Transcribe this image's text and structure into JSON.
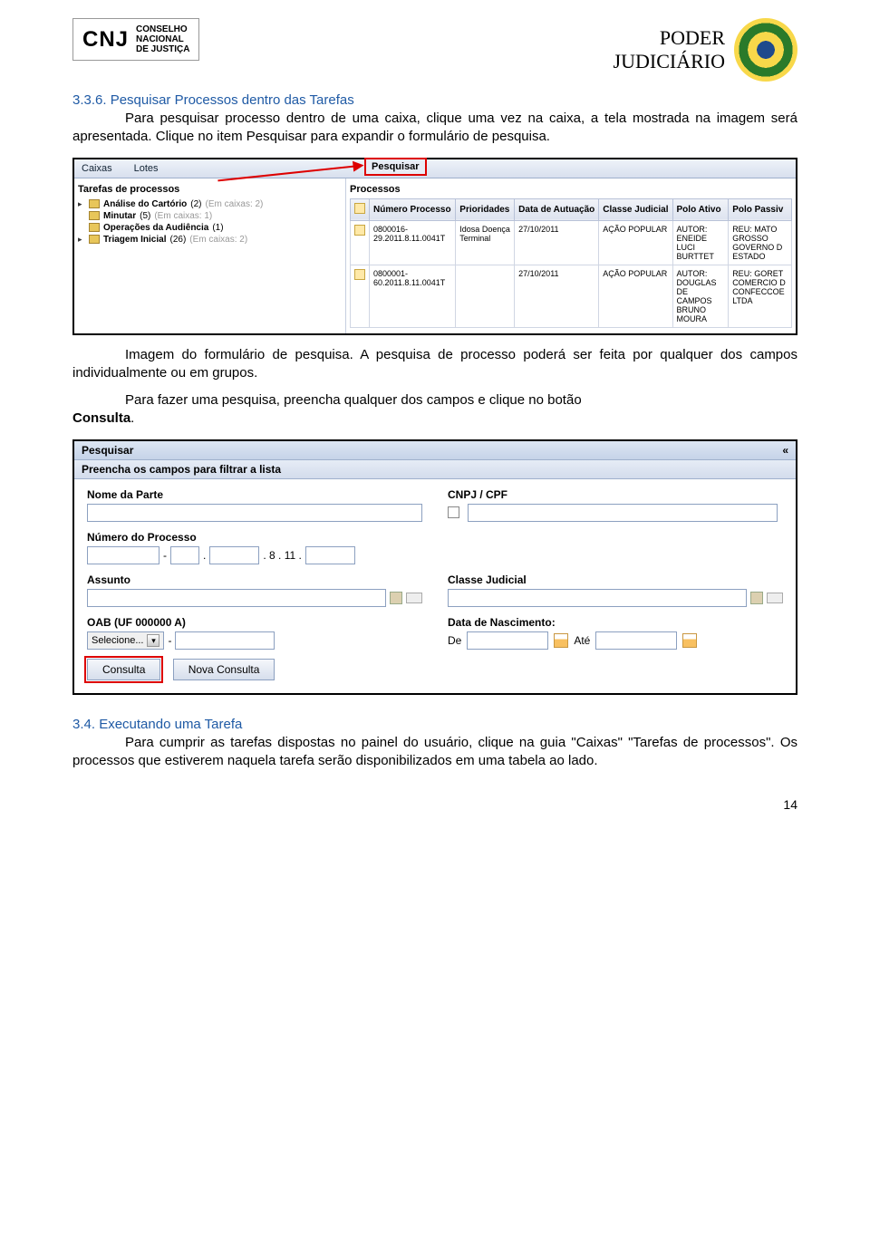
{
  "header": {
    "logo_text": "CNJ",
    "logo_sub1": "CONSELHO",
    "logo_sub2": "NACIONAL",
    "logo_sub3": "DE JUSTIÇA",
    "title_line1": "PODER",
    "title_line2": "JUDICIÁRIO"
  },
  "section1": {
    "number": "3.3.6.",
    "title": "Pesquisar Processos dentro das Tarefas",
    "para1": "Para pesquisar processo dentro de uma caixa, clique uma vez na caixa, a tela mostrada na imagem será apresentada. Clique no item Pesquisar para expandir o formulário de pesquisa.",
    "para2": "Imagem do formulário de pesquisa. A pesquisa de processo poderá ser feita por qualquer dos campos individualmente ou em grupos.",
    "para3a": "Para fazer uma pesquisa, preencha qualquer dos campos e clique no botão ",
    "para3b": "Consulta",
    "para3c": "."
  },
  "screenshot1": {
    "tabs": {
      "caixas": "Caixas",
      "lotes": "Lotes",
      "pesquisar": "Pesquisar"
    },
    "left_header": "Tarefas de processos",
    "tree": [
      {
        "label": "Análise do Cartório",
        "bold": true,
        "count": "(2)",
        "note": "(Em caixas: 2)"
      },
      {
        "label": "Minutar",
        "bold": true,
        "count": "(5)",
        "note": "(Em caixas: 1)"
      },
      {
        "label": "Operações da Audiência",
        "bold": true,
        "count": "(1)",
        "note": ""
      },
      {
        "label": "Triagem Inicial",
        "bold": true,
        "count": "(26)",
        "note": "(Em caixas: 2)"
      }
    ],
    "right_header": "Processos",
    "columns": [
      "",
      "Número Processo",
      "Prioridades",
      "Data de Autuação",
      "Classe Judicial",
      "Polo Ativo",
      "Polo Passiv"
    ],
    "rows": [
      {
        "numero": "0800016-29.2011.8.11.0041T",
        "prioridades": "Idosa Doença Terminal",
        "data": "27/10/2011",
        "classe": "AÇÃO POPULAR",
        "ativo": "AUTOR: ENEIDE LUCI BURTTET",
        "passivo": "REU: MATO GROSSO GOVERNO D ESTADO"
      },
      {
        "numero": "0800001-60.2011.8.11.0041T",
        "prioridades": "",
        "data": "27/10/2011",
        "classe": "AÇÃO POPULAR",
        "ativo": "AUTOR: DOUGLAS DE CAMPOS BRUNO MOURA",
        "passivo": "REU: GORET COMERCIO D CONFECCOE LTDA"
      }
    ]
  },
  "screenshot2": {
    "panel_title": "Pesquisar",
    "collapse": "«",
    "panel_sub": "Preencha os campos para filtrar a lista",
    "labels": {
      "nome": "Nome da Parte",
      "cnpj": "CNPJ / CPF",
      "numero": "Número do Processo",
      "assunto": "Assunto",
      "classe": "Classe Judicial",
      "oab": "OAB (UF 000000 A)",
      "data_nasc": "Data de Nascimento:",
      "de": "De",
      "ate": "Até"
    },
    "proc_num_static": {
      "dot8": ". 8 . 11 ."
    },
    "select_text": "Selecione...",
    "btn_consulta": "Consulta",
    "btn_nova": "Nova Consulta"
  },
  "section2": {
    "number": "3.4.",
    "title": "Executando uma Tarefa",
    "para": "Para cumprir as tarefas dispostas no painel do usuário, clique na guia \"Caixas\" \"Tarefas de processos\". Os processos que estiverem naquela tarefa serão disponibilizados em uma tabela ao lado."
  },
  "page_number": "14"
}
